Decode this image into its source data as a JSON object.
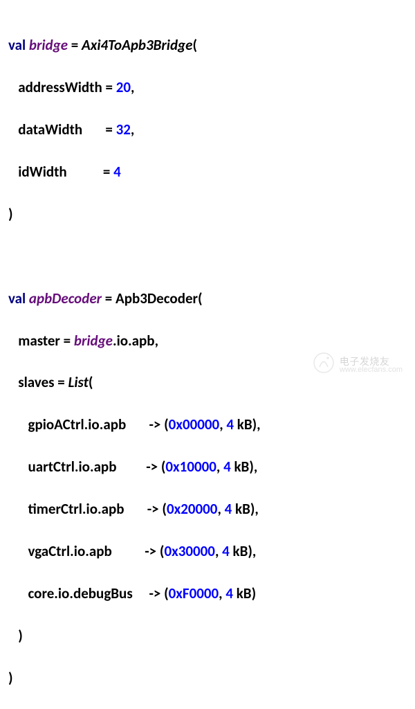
{
  "bridge": {
    "keyword_val": "val",
    "var_name": "bridge",
    "ctor": "Axi4ToApb3Bridge",
    "params": {
      "addressWidth_label": "addressWidth",
      "addressWidth_value": "20",
      "dataWidth_label": "dataWidth",
      "dataWidth_value": "32",
      "idWidth_label": "idWidth",
      "idWidth_value": "4"
    }
  },
  "decoder": {
    "keyword_val": "val",
    "var_name": "apbDecoder",
    "ctor": "Apb3Decoder",
    "master_label": "master",
    "bridge_ref": "bridge",
    "io_apb": ".io.apb,",
    "slaves_label": "slaves",
    "list_ctor": "List",
    "entries": [
      {
        "path": "gpioACtrl.io.apb",
        "addr": "0x00000",
        "size_num": "4",
        "size_unit": " kB),"
      },
      {
        "path": "uartCtrl.io.apb",
        "addr": "0x10000",
        "size_num": "4",
        "size_unit": " kB),"
      },
      {
        "path": "timerCtrl.io.apb",
        "addr": "0x20000",
        "size_num": "4",
        "size_unit": " kB),"
      },
      {
        "path": "vgaCtrl.io.apb",
        "addr": "0x30000",
        "size_num": "4",
        "size_unit": " kB),"
      },
      {
        "path": "core.io.debugBus",
        "addr": "0xF0000",
        "size_num": "4",
        "size_unit": " kB)"
      }
    ]
  },
  "watermark": {
    "cn": "电子发烧友",
    "url": "www.elecfans.com"
  }
}
